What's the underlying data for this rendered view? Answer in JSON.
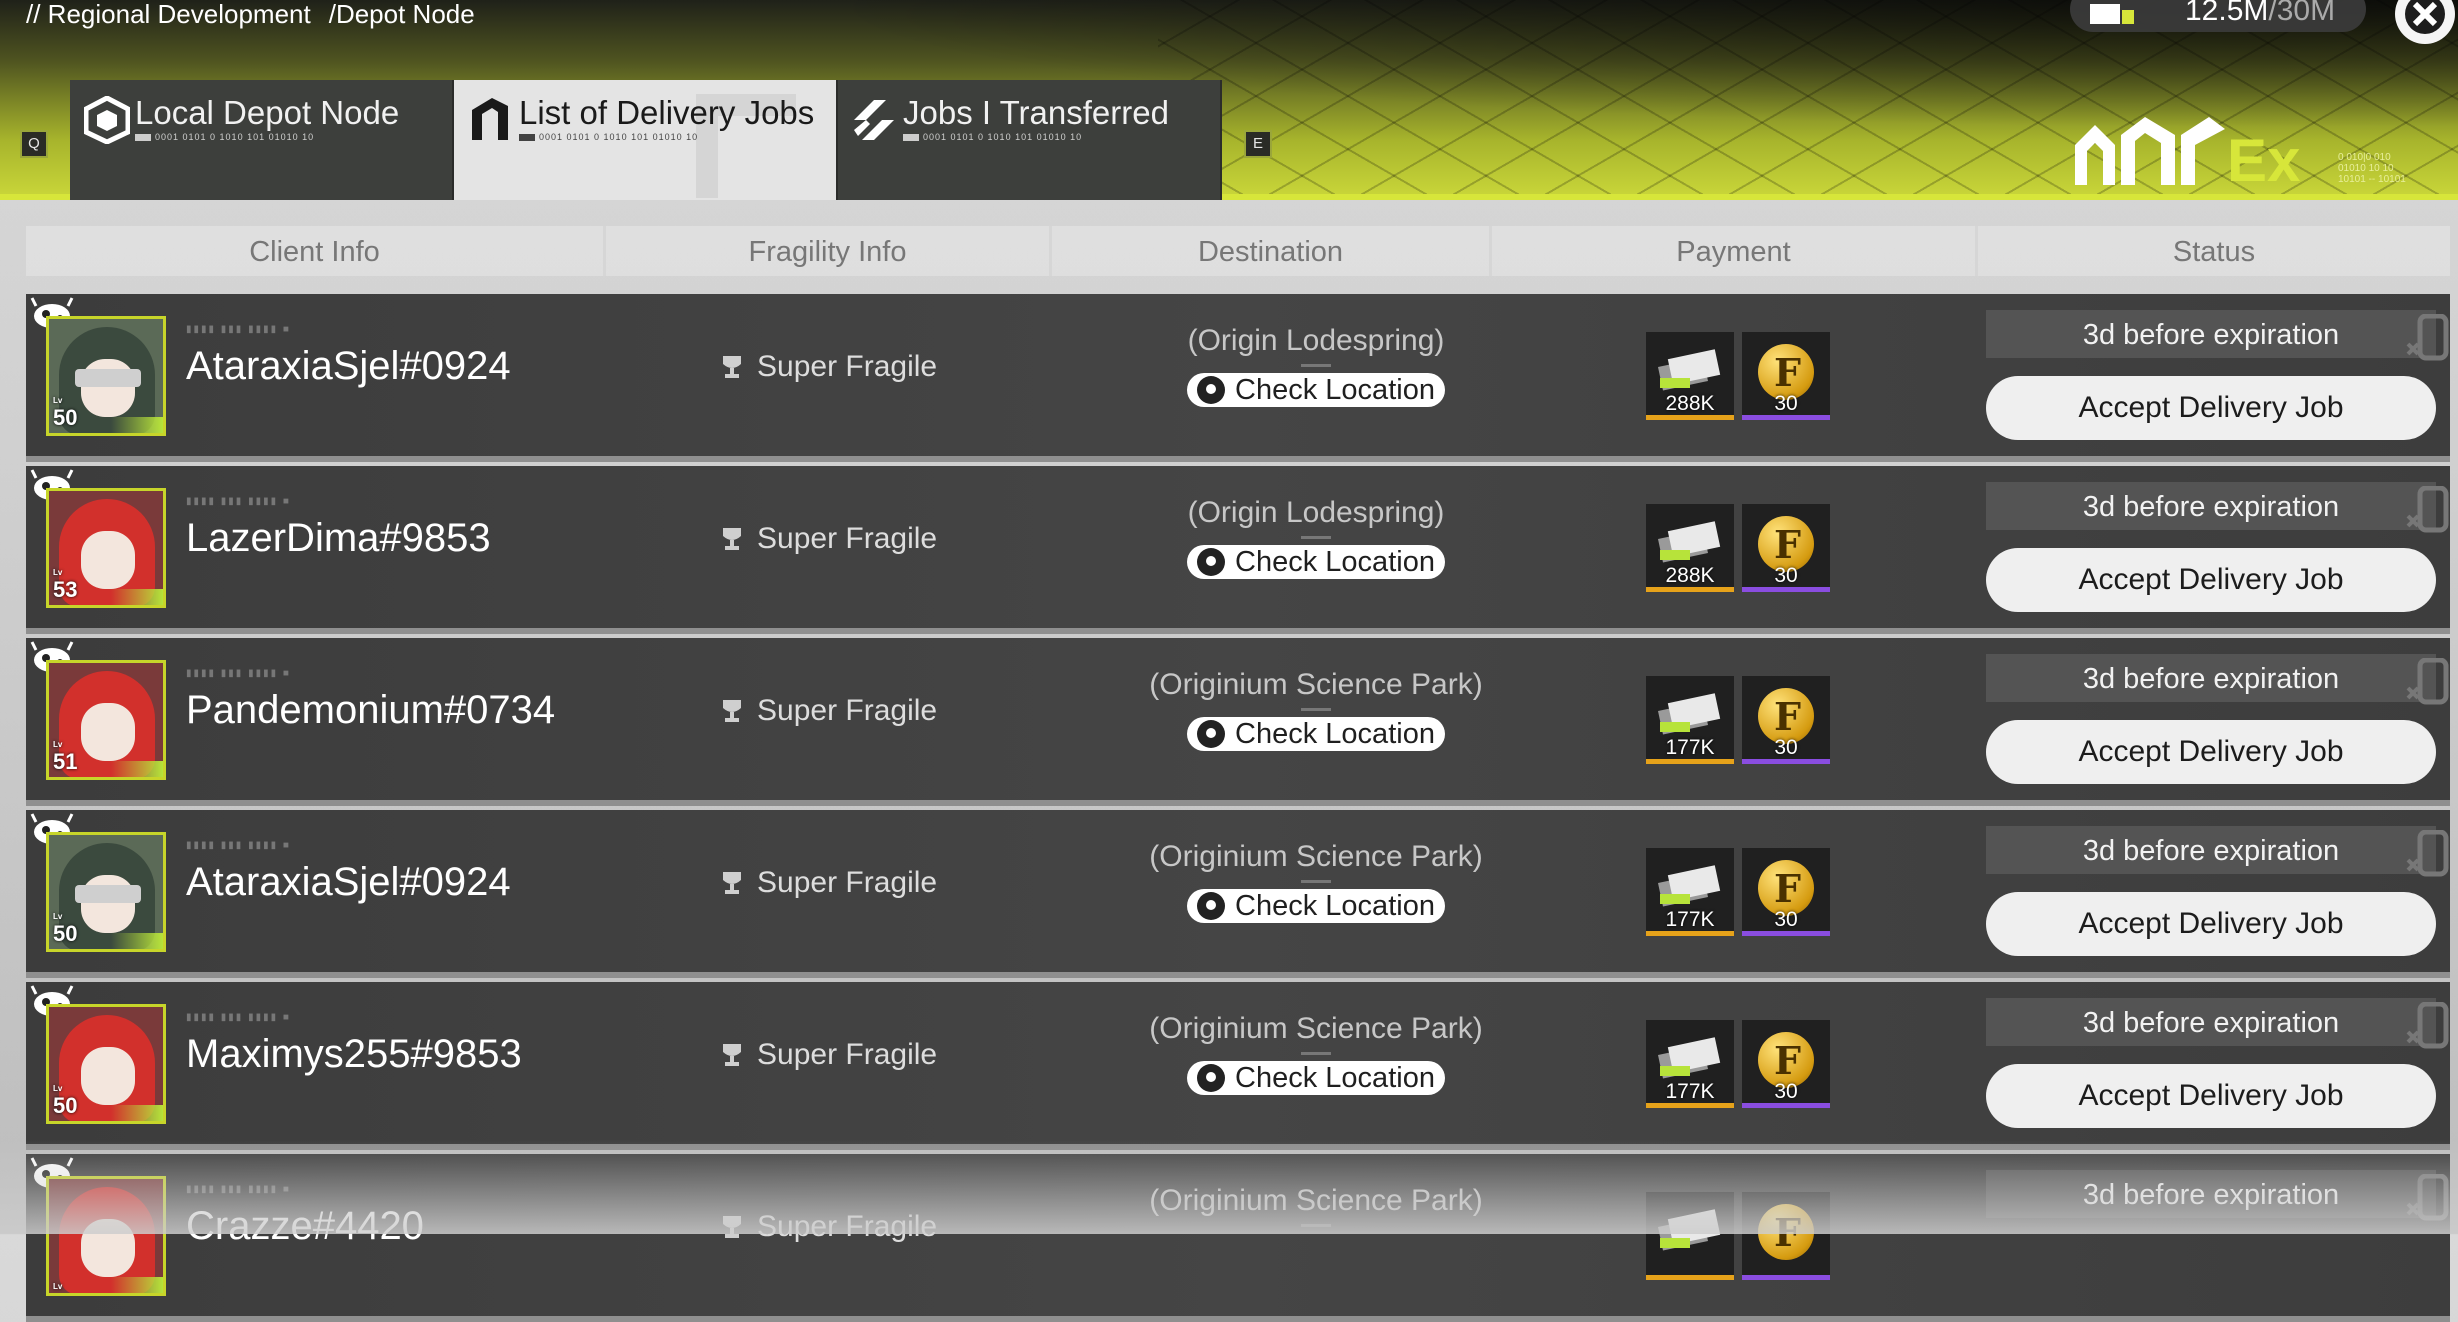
{
  "breadcrumb": {
    "part1": "// Regional Development",
    "part2": "/Depot Node"
  },
  "resource": {
    "current": "12.5M",
    "max": "/30M",
    "icon": "truck-icon"
  },
  "tabs": [
    {
      "label": "Local Depot Node",
      "code": "0001 0101 0 1010 101 01010 10",
      "icon": "depot-icon"
    },
    {
      "label": "List of Delivery Jobs",
      "code": "0001 0101 0 1010 101 01010 10",
      "icon": "delivery-jobs-icon"
    },
    {
      "label": "Jobs I Transferred",
      "code": "0001 0101 0 1010 101 01010 10",
      "icon": "transfer-icon"
    }
  ],
  "key_hints": {
    "left": "Q",
    "right": "E"
  },
  "columns": [
    "Client Info",
    "Fragility Info",
    "Destination",
    "Payment",
    "Status"
  ],
  "rows": [
    {
      "client": "AtaraxiaSjel#0924",
      "level": "50",
      "fragility": "Super Fragile",
      "destination": "(Origin Lodespring)",
      "check": "Check Location",
      "pay_money": "288K",
      "pay_coin": "30",
      "expiry": "3d before expiration",
      "accept": "Accept Delivery Job"
    },
    {
      "client": "LazerDima#9853",
      "level": "53",
      "fragility": "Super Fragile",
      "destination": "(Origin Lodespring)",
      "check": "Check Location",
      "pay_money": "288K",
      "pay_coin": "30",
      "expiry": "3d before expiration",
      "accept": "Accept Delivery Job"
    },
    {
      "client": "Pandemonium#0734",
      "level": "51",
      "fragility": "Super Fragile",
      "destination": "(Originium Science Park)",
      "check": "Check Location",
      "pay_money": "177K",
      "pay_coin": "30",
      "expiry": "3d before expiration",
      "accept": "Accept Delivery Job"
    },
    {
      "client": "AtaraxiaSjel#0924",
      "level": "50",
      "fragility": "Super Fragile",
      "destination": "(Originium Science Park)",
      "check": "Check Location",
      "pay_money": "177K",
      "pay_coin": "30",
      "expiry": "3d before expiration",
      "accept": "Accept Delivery Job"
    },
    {
      "client": "Maximys255#9853",
      "level": "50",
      "fragility": "Super Fragile",
      "destination": "(Originium Science Park)",
      "check": "Check Location",
      "pay_money": "177K",
      "pay_coin": "30",
      "expiry": "3d before expiration",
      "accept": "Accept Delivery Job"
    },
    {
      "client": "Crazze#4420",
      "level": "",
      "fragility": "Super Fragile",
      "destination": "(Originium Science Park)",
      "check": "",
      "pay_money": "",
      "pay_coin": "",
      "expiry": "3d before expiration",
      "accept": ""
    }
  ],
  "colors": {
    "accent": "#c7d52a",
    "row_bg": "#424242",
    "money_bar": "#e6a21a",
    "coin_bar": "#8a4de0"
  }
}
